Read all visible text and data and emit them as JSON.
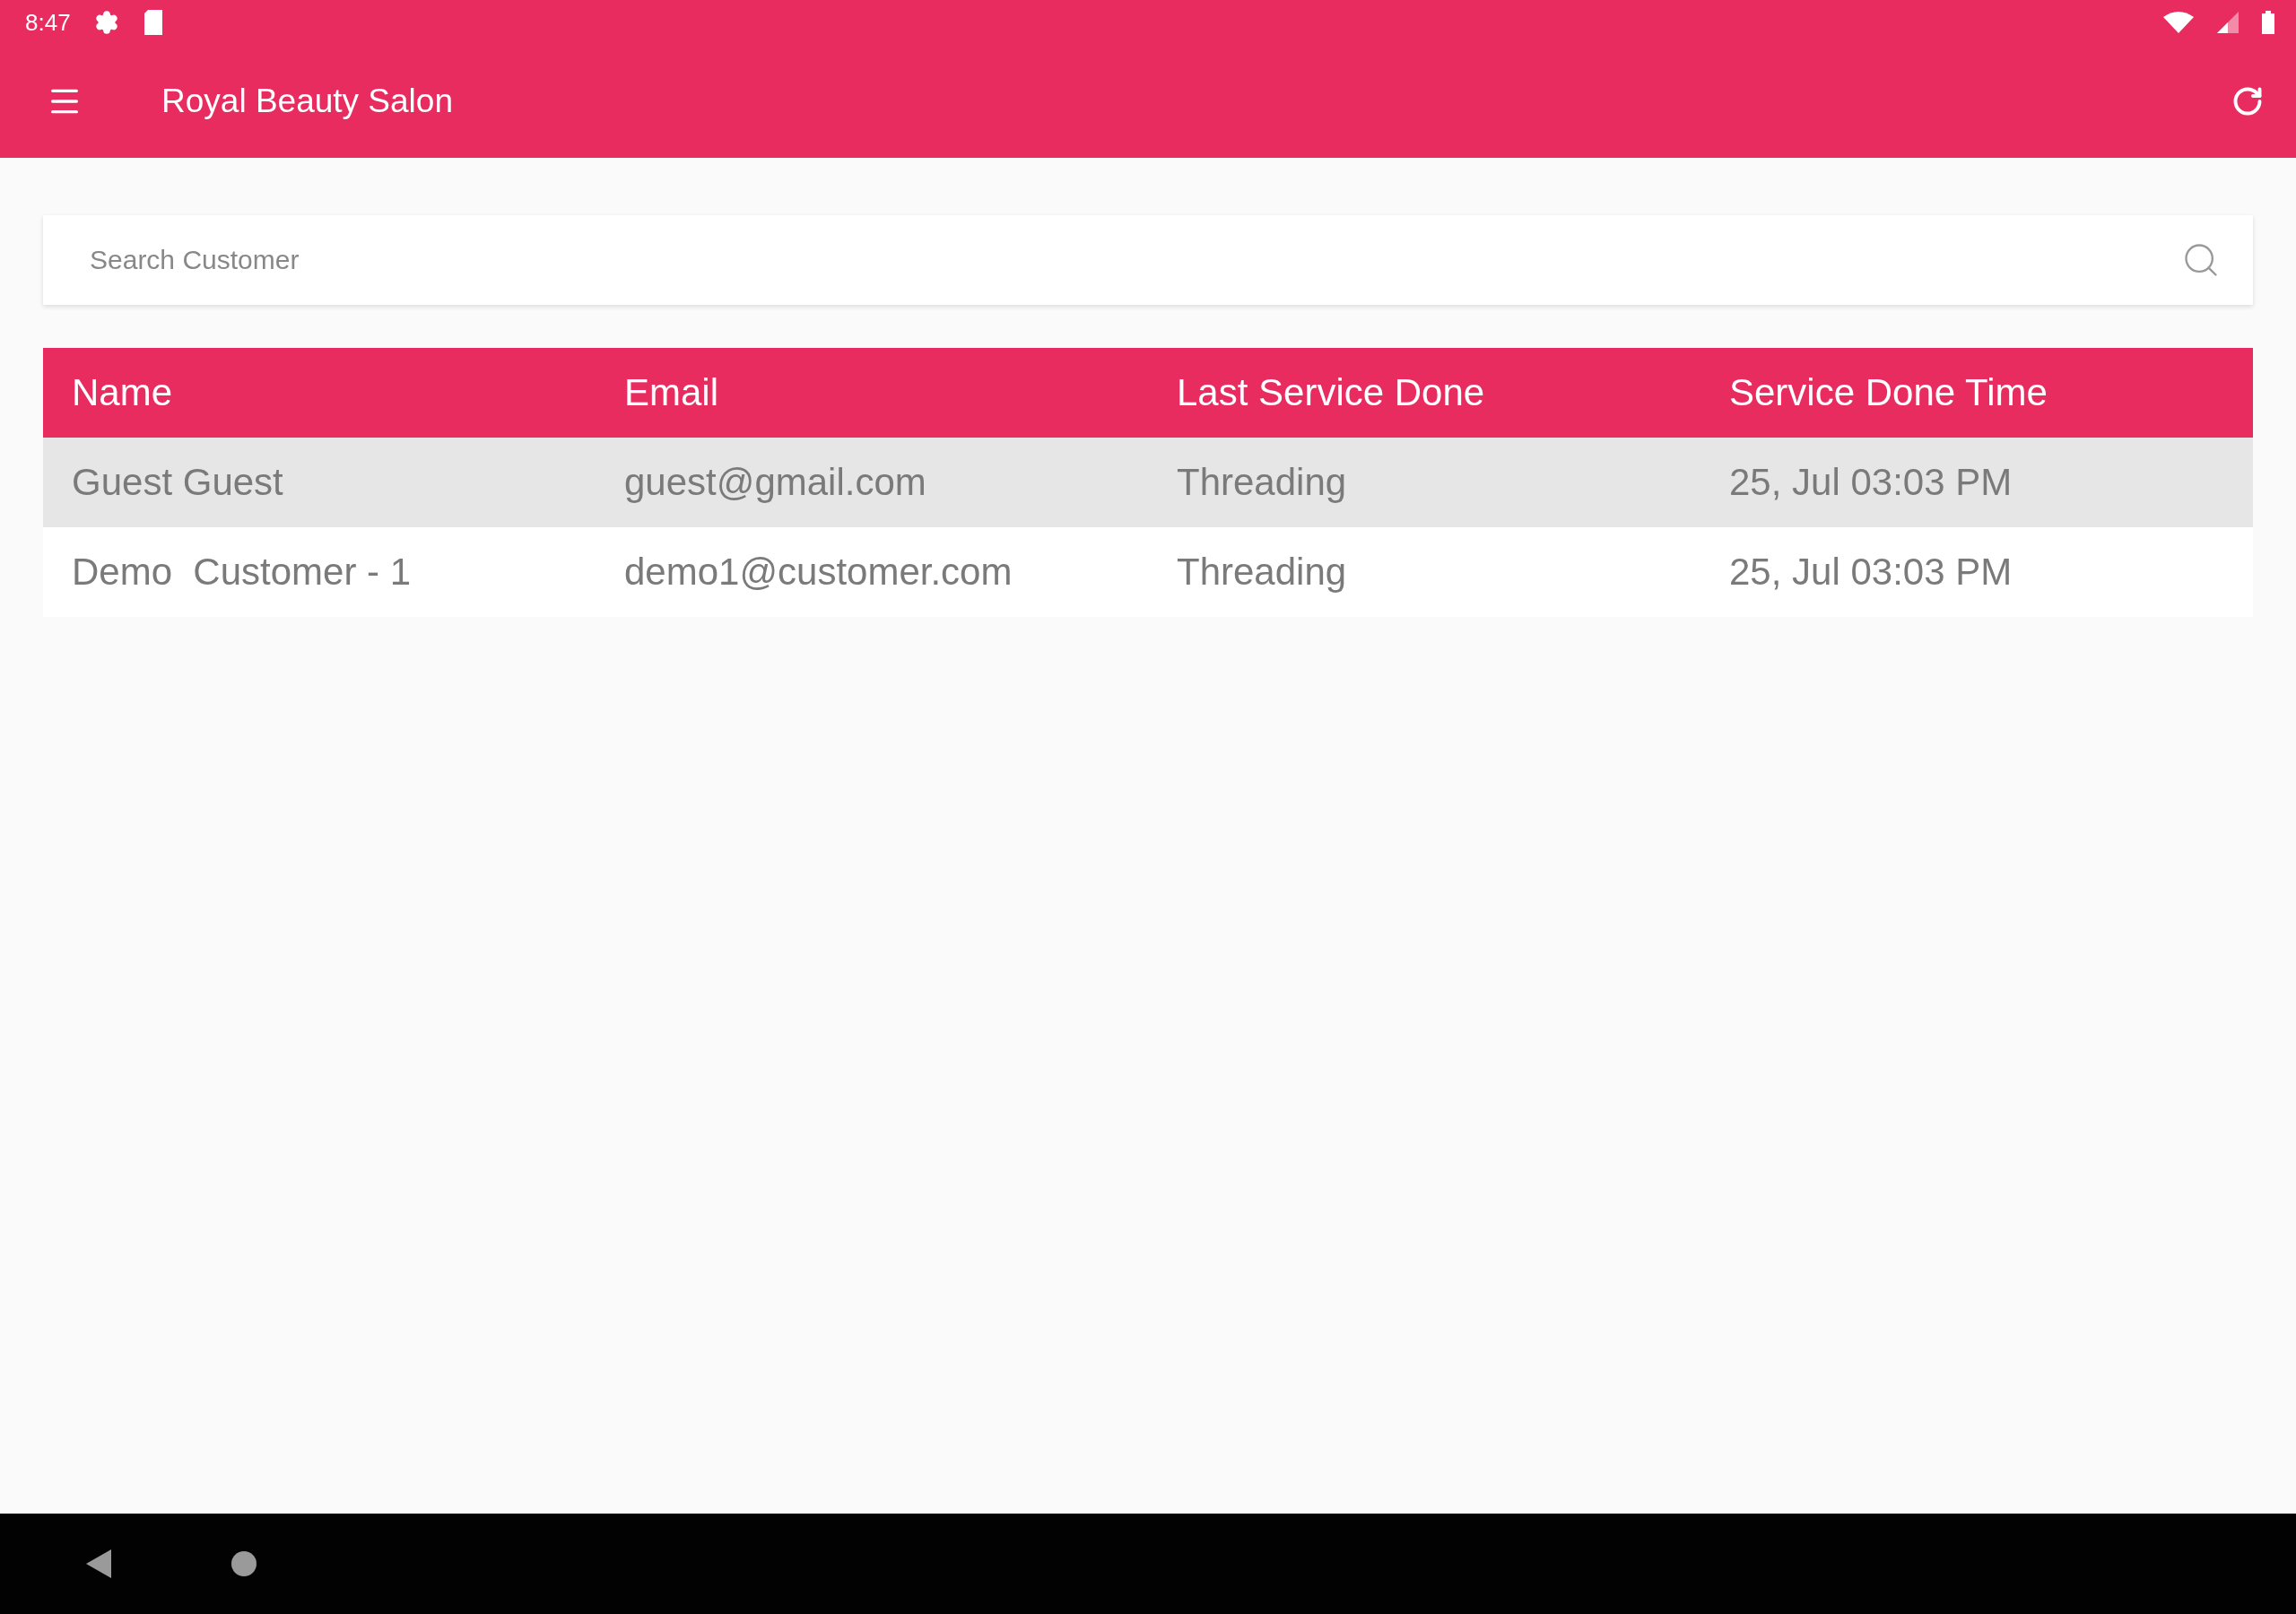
{
  "status_bar": {
    "time": "8:47"
  },
  "app_bar": {
    "title": "Royal Beauty Salon"
  },
  "search": {
    "placeholder": "Search Customer"
  },
  "table": {
    "columns": [
      "Name",
      "Email",
      "Last Service Done",
      "Service Done Time"
    ],
    "rows": [
      [
        "Guest Guest",
        "guest@gmail.com",
        "Threading",
        "25, Jul 03:03 PM"
      ],
      [
        "Demo  Customer - 1",
        "demo1@customer.com",
        "Threading",
        "25, Jul 03:03 PM"
      ]
    ]
  }
}
